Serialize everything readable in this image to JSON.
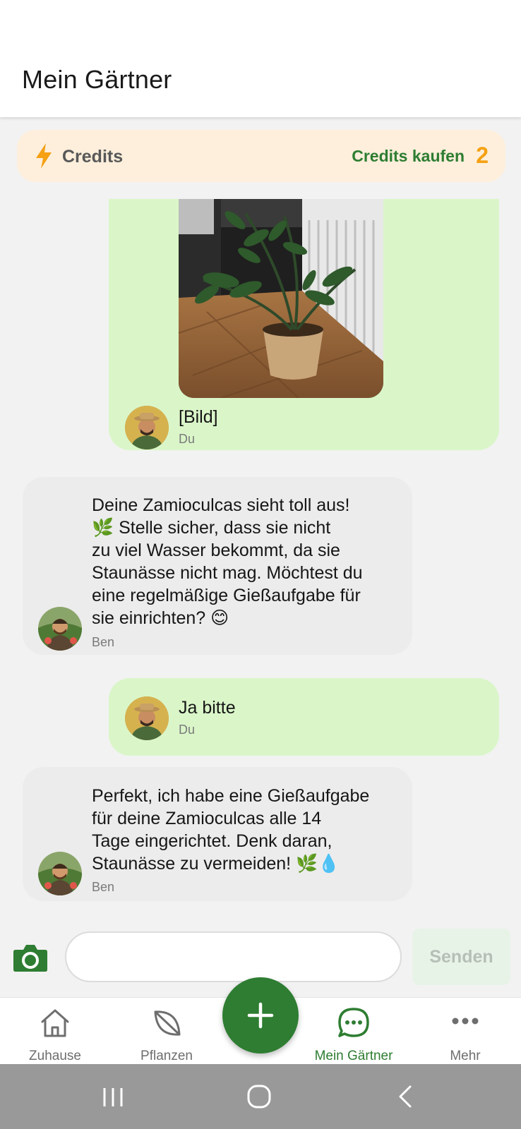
{
  "header": {
    "title": "Mein Gärtner"
  },
  "credits": {
    "label": "Credits",
    "buy_label": "Credits kaufen",
    "count": "2",
    "accent_color": "#f5a113",
    "bg_color": "#fdefdc"
  },
  "messages": [
    {
      "from": "user",
      "type": "image",
      "text": "[Bild]",
      "sender": "Du"
    },
    {
      "from": "bot",
      "text": "Deine Zamioculcas sieht toll aus!\n🌿 Stelle sicher, dass sie nicht\nzu viel Wasser bekommt, da sie\nStaunässe nicht mag. Möchtest du\neine regelmäßige Gießaufgabe für\nsie einrichten? 😊",
      "sender": "Ben"
    },
    {
      "from": "user",
      "text": "Ja bitte",
      "sender": "Du"
    },
    {
      "from": "bot",
      "text": "Perfekt, ich habe eine Gießaufgabe\nfür deine Zamioculcas alle 14\nTage eingerichtet. Denk daran,\nStaunässe zu vermeiden! 🌿💧",
      "sender": "Ben"
    }
  ],
  "composer": {
    "placeholder": "",
    "value": "",
    "send_label": "Senden",
    "camera_icon": "camera-icon"
  },
  "nav": {
    "items": [
      {
        "label": "Zuhause",
        "icon": "home-icon"
      },
      {
        "label": "Pflanzen",
        "icon": "leaf-icon"
      },
      {
        "label": "Mein Gärtner",
        "icon": "chat-icon",
        "active": true
      },
      {
        "label": "Mehr",
        "icon": "more-icon"
      }
    ],
    "fab_icon": "plus-icon",
    "active_color": "#2e7d32"
  },
  "system_nav": {
    "icons": [
      "recent-apps-icon",
      "home-circle-icon",
      "back-icon"
    ]
  },
  "colors": {
    "user_bubble": "#daf6c9",
    "bot_bubble": "#ececec",
    "brand_green": "#2e7d32"
  }
}
